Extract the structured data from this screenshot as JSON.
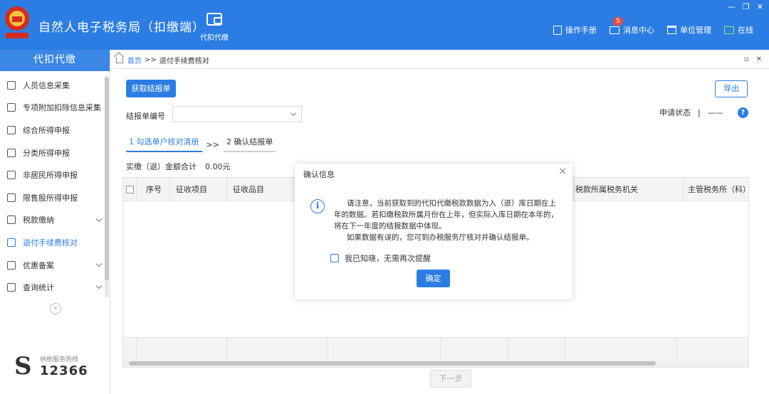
{
  "app": {
    "title": "自然人电子税务局（扣缴端）",
    "logo_text": "中国税务",
    "module_label": "代扣代缴"
  },
  "top_actions": [
    {
      "label": "操作手册",
      "icon": "manual-icon"
    },
    {
      "label": "消息中心",
      "icon": "message-icon",
      "badge": "5"
    },
    {
      "label": "单位管理",
      "icon": "building-icon"
    },
    {
      "label": "在线",
      "icon": "online-monitor-icon"
    }
  ],
  "window_controls": [
    "—",
    "❐",
    "✕"
  ],
  "sidebar": {
    "header": "代扣代缴",
    "items": [
      {
        "label": "人员信息采集",
        "expandable": false,
        "active": false
      },
      {
        "label": "专项附加扣除信息采集",
        "expandable": false,
        "active": false
      },
      {
        "label": "综合所得申报",
        "expandable": false,
        "active": false
      },
      {
        "label": "分类所得申报",
        "expandable": false,
        "active": false
      },
      {
        "label": "非居民所得申报",
        "expandable": false,
        "active": false
      },
      {
        "label": "限售股所得申报",
        "expandable": false,
        "active": false
      },
      {
        "label": "税款缴纳",
        "expandable": true,
        "active": false
      },
      {
        "label": "退付手续费核对",
        "expandable": false,
        "active": true
      },
      {
        "label": "优惠备案",
        "expandable": true,
        "active": false
      },
      {
        "label": "查询统计",
        "expandable": true,
        "active": false
      }
    ],
    "collapse_glyph": "«",
    "hotline_label": "纳税服务热线",
    "hotline_number": "12366"
  },
  "breadcrumb": {
    "home": "首页",
    "separator": ">>",
    "current": "退付手续费核对"
  },
  "toolbar": {
    "fetch_button": "获取结报单",
    "export_button": "导出"
  },
  "filter": {
    "report_no_label": "结报单编号",
    "report_no_value": "",
    "status_label": "申请状态",
    "status_sep": "|",
    "status_value": "——",
    "help_glyph": "?"
  },
  "steps": {
    "step1": "1 勾选单户核对清册",
    "separator": ">>",
    "step2": "2 确认结报单"
  },
  "summary": {
    "label": "实缴（退）金额合计",
    "value": "0.00元"
  },
  "table": {
    "columns": [
      "序号",
      "征收项目",
      "征收品目",
      "",
      "",
      "",
      "",
      "税款所属税务机关",
      "主管税务所（科）"
    ]
  },
  "footer": {
    "next_button": "下一步"
  },
  "dialog": {
    "title": "确认信息",
    "close_glyph": "×",
    "paragraph1": "请注意，当前获取到的代扣代缴税款数据为入（退）库日期在上年的数据。若扣缴税款所属月份在上年，但实际入库日期在本年的，将在下一年度的结报数据中体现。",
    "paragraph2": "如果数据有误的，您可到办税服务厅核对并确认结报单。",
    "checkbox_label": "我已知晓，无需再次提醒",
    "checkbox_checked": false,
    "ok_button": "确定"
  },
  "colors": {
    "primary": "#2b7de3",
    "online": "#8ef07a",
    "badge": "#f04a3a"
  }
}
